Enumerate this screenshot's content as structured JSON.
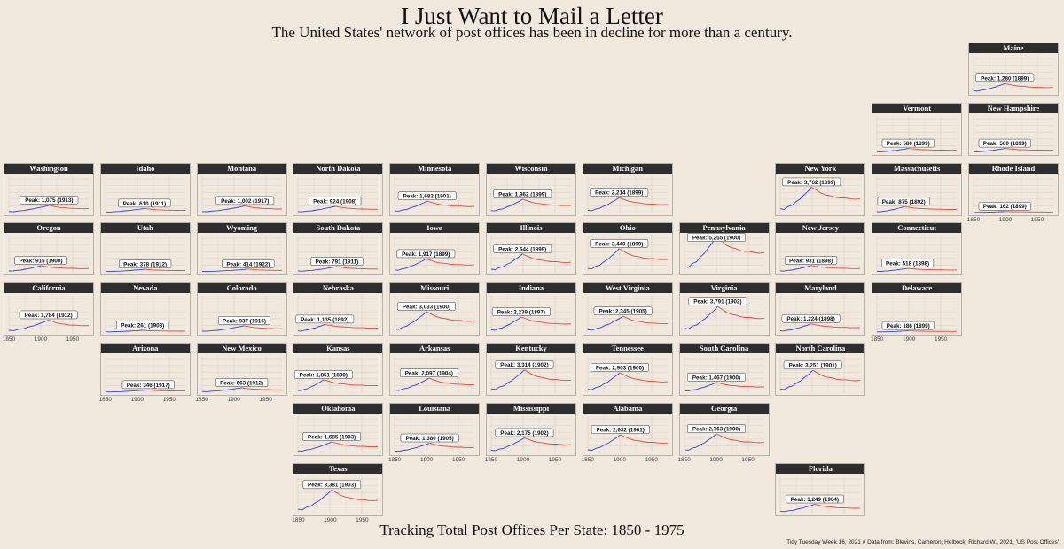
{
  "title": "I Just Want to Mail a Letter",
  "subtitle": "The United States' network of post offices has been in decline for more than a century.",
  "footer_title": "Tracking Total Post Offices Per State: 1850 - 1975",
  "caption": "Tidy Tuesday Week 16, 2021 // Data from: Blevins, Cameron; Helbock, Richard W., 2021, 'US Post Offices'",
  "colors": {
    "background": "#f1e8de",
    "strip": "#2e2e2e",
    "rising": "#3b3fd8",
    "declining": "#e8463a"
  },
  "chart_data": {
    "type": "line",
    "facet": "state",
    "x_range": [
      1850,
      1975
    ],
    "x_ticks": [
      1850,
      1900,
      1950
    ],
    "y_range": [
      0,
      5400
    ],
    "grid": true,
    "panels": [
      {
        "state": "Maine",
        "peak": 1280,
        "peak_year": 1899,
        "label": "Peak: 1,280 (1899)",
        "row": 0,
        "col": 10,
        "axis": false
      },
      {
        "state": "Vermont",
        "peak": 580,
        "peak_year": 1899,
        "label": "Peak: 580 (1899)",
        "row": 1,
        "col": 9,
        "axis": false
      },
      {
        "state": "New Hampshire",
        "peak": 580,
        "peak_year": 1899,
        "label": "Peak: 580 (1899)",
        "row": 1,
        "col": 10,
        "axis": false
      },
      {
        "state": "Washington",
        "peak": 1075,
        "peak_year": 1913,
        "label": "Peak: 1,075 (1913)",
        "row": 2,
        "col": 0,
        "axis": false
      },
      {
        "state": "Idaho",
        "peak": 610,
        "peak_year": 1911,
        "label": "Peak: 610 (1911)",
        "row": 2,
        "col": 1,
        "axis": false
      },
      {
        "state": "Montana",
        "peak": 1002,
        "peak_year": 1917,
        "label": "Peak: 1,002 (1917)",
        "row": 2,
        "col": 2,
        "axis": false
      },
      {
        "state": "North Dakota",
        "peak": 924,
        "peak_year": 1908,
        "label": "Peak: 924 (1908)",
        "row": 2,
        "col": 3,
        "axis": false
      },
      {
        "state": "Minnesota",
        "peak": 1682,
        "peak_year": 1901,
        "label": "Peak: 1,682 (1901)",
        "row": 2,
        "col": 4,
        "axis": false
      },
      {
        "state": "Wisconsin",
        "peak": 1962,
        "peak_year": 1899,
        "label": "Peak: 1,962 (1899)",
        "row": 2,
        "col": 5,
        "axis": false
      },
      {
        "state": "Michigan",
        "peak": 2214,
        "peak_year": 1899,
        "label": "Peak: 2,214 (1899)",
        "row": 2,
        "col": 6,
        "axis": false
      },
      {
        "state": "New York",
        "peak": 3762,
        "peak_year": 1899,
        "label": "Peak: 3,762 (1899)",
        "row": 2,
        "col": 8,
        "axis": false
      },
      {
        "state": "Massachusetts",
        "peak": 875,
        "peak_year": 1892,
        "label": "Peak: 875 (1892)",
        "row": 2,
        "col": 9,
        "axis": false
      },
      {
        "state": "Rhode Island",
        "peak": 162,
        "peak_year": 1899,
        "label": "Peak: 162 (1899)",
        "row": 2,
        "col": 10,
        "axis": true
      },
      {
        "state": "Oregon",
        "peak": 915,
        "peak_year": 1900,
        "label": "Peak: 915 (1900)",
        "row": 3,
        "col": 0,
        "axis": false
      },
      {
        "state": "Utah",
        "peak": 378,
        "peak_year": 1912,
        "label": "Peak: 378 (1912)",
        "row": 3,
        "col": 1,
        "axis": false
      },
      {
        "state": "Wyoming",
        "peak": 414,
        "peak_year": 1922,
        "label": "Peak: 414 (1922)",
        "row": 3,
        "col": 2,
        "axis": false
      },
      {
        "state": "South Dakota",
        "peak": 791,
        "peak_year": 1911,
        "label": "Peak: 791 (1911)",
        "row": 3,
        "col": 3,
        "axis": false
      },
      {
        "state": "Iowa",
        "peak": 1917,
        "peak_year": 1899,
        "label": "Peak: 1,917 (1899)",
        "row": 3,
        "col": 4,
        "axis": false
      },
      {
        "state": "Illinois",
        "peak": 2644,
        "peak_year": 1899,
        "label": "Peak: 2,644 (1899)",
        "row": 3,
        "col": 5,
        "axis": false
      },
      {
        "state": "Ohio",
        "peak": 3440,
        "peak_year": 1899,
        "label": "Peak: 3,440 (1899)",
        "row": 3,
        "col": 6,
        "axis": false
      },
      {
        "state": "Pennsylvania",
        "peak": 5255,
        "peak_year": 1900,
        "label": "Peak: 5,255 (1900)",
        "row": 3,
        "col": 7,
        "axis": false
      },
      {
        "state": "New Jersey",
        "peak": 931,
        "peak_year": 1898,
        "label": "Peak: 931 (1898)",
        "row": 3,
        "col": 8,
        "axis": false
      },
      {
        "state": "Connecticut",
        "peak": 518,
        "peak_year": 1898,
        "label": "Peak: 518 (1898)",
        "row": 3,
        "col": 9,
        "axis": false
      },
      {
        "state": "California",
        "peak": 1784,
        "peak_year": 1912,
        "label": "Peak: 1,784 (1912)",
        "row": 4,
        "col": 0,
        "axis": true
      },
      {
        "state": "Nevada",
        "peak": 261,
        "peak_year": 1908,
        "label": "Peak: 261 (1908)",
        "row": 4,
        "col": 1,
        "axis": false
      },
      {
        "state": "Colorado",
        "peak": 937,
        "peak_year": 1916,
        "label": "Peak: 937 (1916)",
        "row": 4,
        "col": 2,
        "axis": false
      },
      {
        "state": "Nebraska",
        "peak": 1135,
        "peak_year": 1892,
        "label": "Peak: 1,135 (1892)",
        "row": 4,
        "col": 3,
        "axis": false
      },
      {
        "state": "Missouri",
        "peak": 3033,
        "peak_year": 1900,
        "label": "Peak: 3,033 (1900)",
        "row": 4,
        "col": 4,
        "axis": false
      },
      {
        "state": "Indiana",
        "peak": 2239,
        "peak_year": 1897,
        "label": "Peak: 2,239 (1897)",
        "row": 4,
        "col": 5,
        "axis": false
      },
      {
        "state": "West Virginia",
        "peak": 2345,
        "peak_year": 1905,
        "label": "Peak: 2,345 (1905)",
        "row": 4,
        "col": 6,
        "axis": false
      },
      {
        "state": "Virginia",
        "peak": 3791,
        "peak_year": 1902,
        "label": "Peak: 3,791 (1902)",
        "row": 4,
        "col": 7,
        "axis": false
      },
      {
        "state": "Maryland",
        "peak": 1224,
        "peak_year": 1898,
        "label": "Peak: 1,224 (1898)",
        "row": 4,
        "col": 8,
        "axis": false
      },
      {
        "state": "Delaware",
        "peak": 186,
        "peak_year": 1899,
        "label": "Peak: 186 (1899)",
        "row": 4,
        "col": 9,
        "axis": true
      },
      {
        "state": "Arizona",
        "peak": 346,
        "peak_year": 1917,
        "label": "Peak: 346 (1917)",
        "row": 5,
        "col": 1,
        "axis": true
      },
      {
        "state": "New Mexico",
        "peak": 663,
        "peak_year": 1912,
        "label": "Peak: 663 (1912)",
        "row": 5,
        "col": 2,
        "axis": true
      },
      {
        "state": "Kansas",
        "peak": 1851,
        "peak_year": 1890,
        "label": "Peak: 1,851 (1890)",
        "row": 5,
        "col": 3,
        "axis": false
      },
      {
        "state": "Arkansas",
        "peak": 2097,
        "peak_year": 1904,
        "label": "Peak: 2,097 (1904)",
        "row": 5,
        "col": 4,
        "axis": false
      },
      {
        "state": "Kentucky",
        "peak": 3314,
        "peak_year": 1902,
        "label": "Peak: 3,314 (1902)",
        "row": 5,
        "col": 5,
        "axis": false
      },
      {
        "state": "Tennessee",
        "peak": 2903,
        "peak_year": 1900,
        "label": "Peak: 2,903 (1900)",
        "row": 5,
        "col": 6,
        "axis": false
      },
      {
        "state": "South Carolina",
        "peak": 1467,
        "peak_year": 1900,
        "label": "Peak: 1,467 (1900)",
        "row": 5,
        "col": 7,
        "axis": false
      },
      {
        "state": "North Carolina",
        "peak": 3251,
        "peak_year": 1901,
        "label": "Peak: 3,251 (1901)",
        "row": 5,
        "col": 8,
        "axis": false
      },
      {
        "state": "Oklahoma",
        "peak": 1585,
        "peak_year": 1903,
        "label": "Peak: 1,585 (1903)",
        "row": 6,
        "col": 3,
        "axis": false
      },
      {
        "state": "Louisiana",
        "peak": 1380,
        "peak_year": 1905,
        "label": "Peak: 1,380 (1905)",
        "row": 6,
        "col": 4,
        "axis": true
      },
      {
        "state": "Mississippi",
        "peak": 2175,
        "peak_year": 1902,
        "label": "Peak: 2,175 (1902)",
        "row": 6,
        "col": 5,
        "axis": true
      },
      {
        "state": "Alabama",
        "peak": 2632,
        "peak_year": 1901,
        "label": "Peak: 2,632 (1901)",
        "row": 6,
        "col": 6,
        "axis": true
      },
      {
        "state": "Georgia",
        "peak": 2763,
        "peak_year": 1900,
        "label": "Peak: 2,763 (1900)",
        "row": 6,
        "col": 7,
        "axis": true
      },
      {
        "state": "Texas",
        "peak": 3381,
        "peak_year": 1903,
        "label": "Peak: 3,381 (1903)",
        "row": 7,
        "col": 3,
        "axis": true
      },
      {
        "state": "Florida",
        "peak": 1249,
        "peak_year": 1904,
        "label": "Peak: 1,249 (1904)",
        "row": 7,
        "col": 8,
        "axis": false
      }
    ]
  }
}
